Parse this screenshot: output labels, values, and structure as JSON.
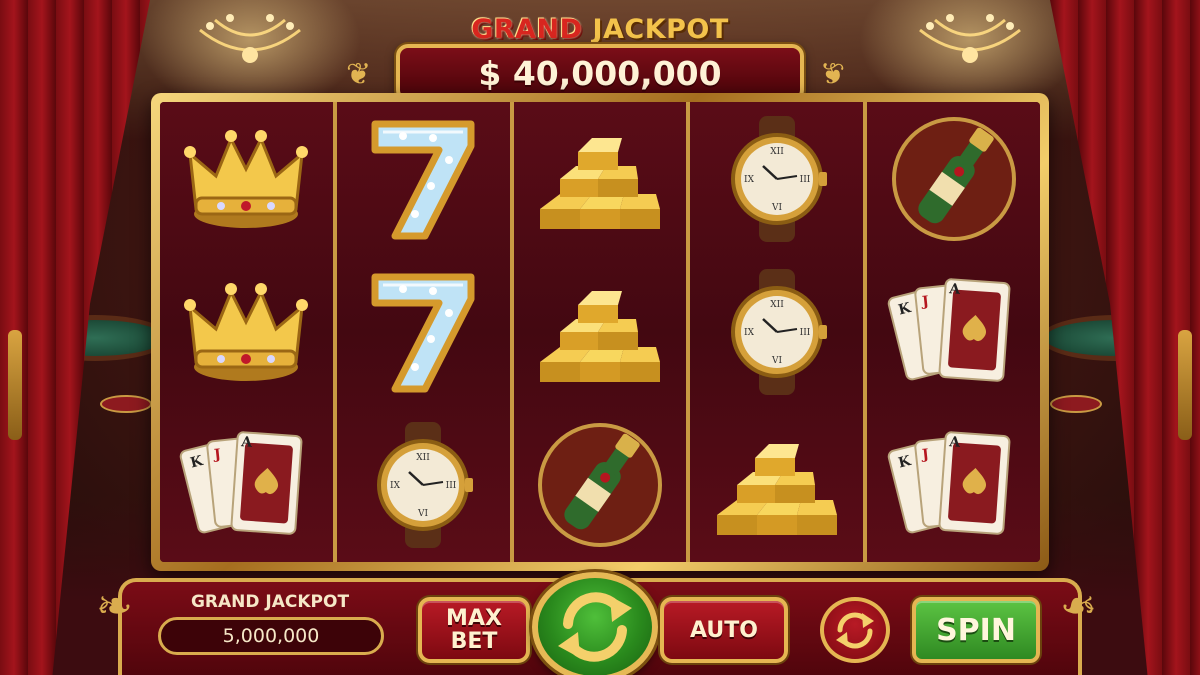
{
  "game": {
    "banner_title_grand": "GRAND",
    "banner_title_jackpot": "JACKPOT",
    "banner_amount": "$ 40,000,000"
  },
  "reels": [
    [
      "crown",
      "crown",
      "cards"
    ],
    [
      "diamond-seven",
      "diamond-seven",
      "watch"
    ],
    [
      "gold-bars",
      "gold-bars",
      "champagne"
    ],
    [
      "watch",
      "watch",
      "gold-bars"
    ],
    [
      "champagne",
      "cards",
      "cards"
    ]
  ],
  "panel": {
    "grand_jackpot_label": "GRAND JACKPOT",
    "grand_jackpot_value": "5,000,000",
    "max_bet_line1": "MAX",
    "max_bet_line2": "BET",
    "auto_label": "AUTO",
    "spin_label": "SPIN"
  },
  "colors": {
    "accent_gold": "#e5b652",
    "panel_red": "#7b0c16",
    "spin_green": "#2f8a22",
    "grand_red": "#d8261f"
  }
}
